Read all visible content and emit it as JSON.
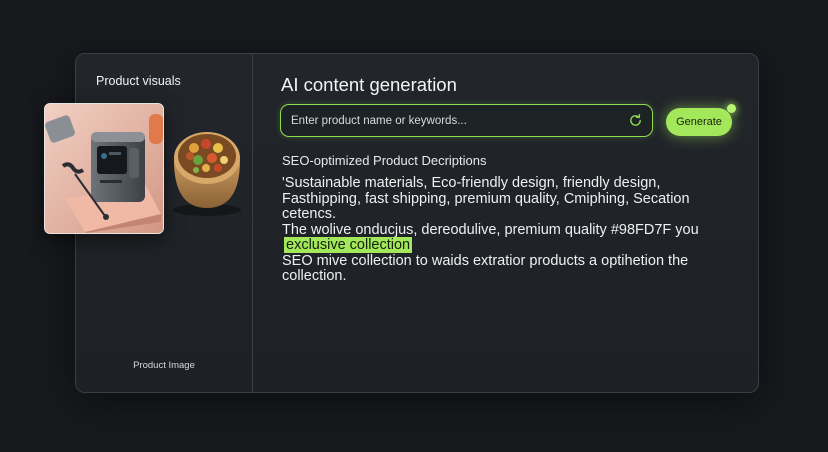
{
  "left_panel": {
    "title": "Product visuals",
    "caption": "Product Image"
  },
  "main": {
    "heading": "AI content generation",
    "search": {
      "placeholder": "Enter product name or keywords...",
      "value": ""
    },
    "generate_label": "Generate",
    "subheading": "SEO-optimized Product Decriptions",
    "para1_line1": "'Sustainable materials, Eco-friendly design, friendly design,",
    "para1_line2": "Fasthipping, fast shipping, premium quality, Cmiphing, Secation",
    "para1_line3": "cetencs.",
    "para2_line1": "The wolive onducjus, dereodulive, premium quality #98FD7F you",
    "highlight": "exclusive collection",
    "para3_line1": "SEO mive collection  to waids extratior products a optihetion the",
    "para3_line2": "collection."
  },
  "colors": {
    "accent": "#A3E85B",
    "background": "#17191D",
    "card": "#22262B"
  },
  "icons": {
    "refresh": "refresh-icon"
  }
}
